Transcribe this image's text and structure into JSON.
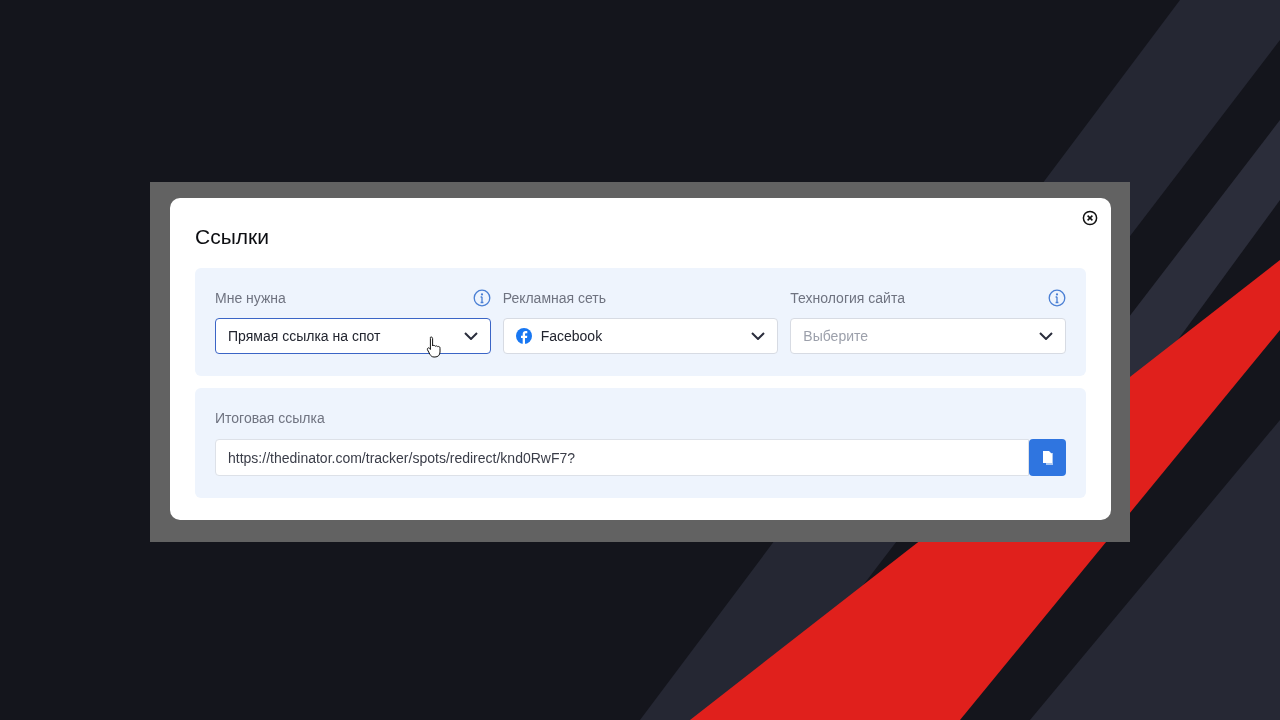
{
  "dialog": {
    "title": "Ссылки",
    "selectors": [
      {
        "label": "Мне нужна",
        "info": true,
        "value": "Прямая ссылка на спот",
        "focused": true,
        "has_icon": false
      },
      {
        "label": "Рекламная сеть",
        "info": false,
        "value": "Facebook",
        "focused": false,
        "has_icon": true
      },
      {
        "label": "Технология сайта",
        "info": true,
        "placeholder": "Выберите",
        "focused": false,
        "has_icon": false
      }
    ],
    "result": {
      "label": "Итоговая ссылка",
      "value": "https://thedinator.com/tracker/spots/redirect/knd0RwF7?"
    }
  }
}
